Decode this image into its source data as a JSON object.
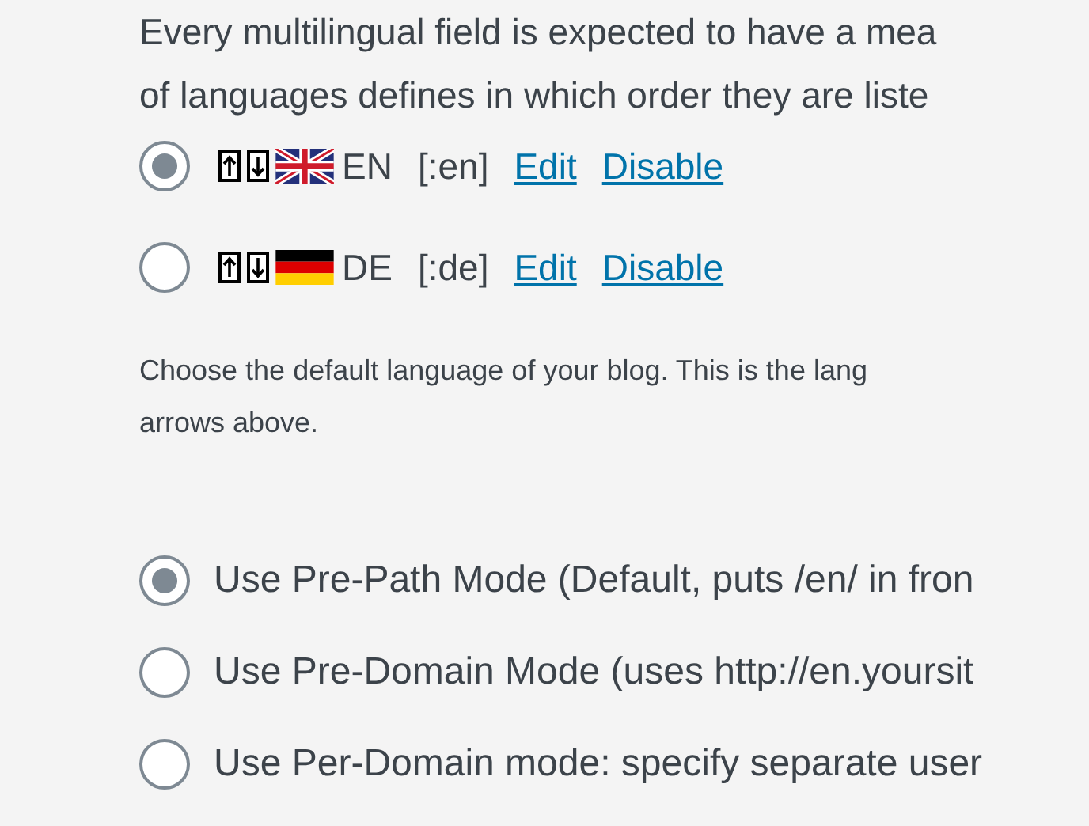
{
  "intro": [
    "Every multilingual field is expected to have a mea",
    "of languages defines in which order they are liste"
  ],
  "languages": [
    {
      "selected": true,
      "kind": "uk",
      "name": "EN",
      "code": "[:en]",
      "edit": "Edit",
      "disable": "Disable"
    },
    {
      "selected": false,
      "kind": "de",
      "name": "DE",
      "code": "[:de]",
      "edit": "Edit",
      "disable": "Disable"
    }
  ],
  "default_hint": [
    "Choose the default language of your blog. This is the lang",
    "arrows above."
  ],
  "url_modes": [
    {
      "selected": true,
      "label": "Use Pre-Path Mode (Default, puts /en/ in fron"
    },
    {
      "selected": false,
      "label": "Use Pre-Domain Mode (uses http://en.yoursit"
    },
    {
      "selected": false,
      "label": "Use Per-Domain mode: specify separate user"
    }
  ]
}
